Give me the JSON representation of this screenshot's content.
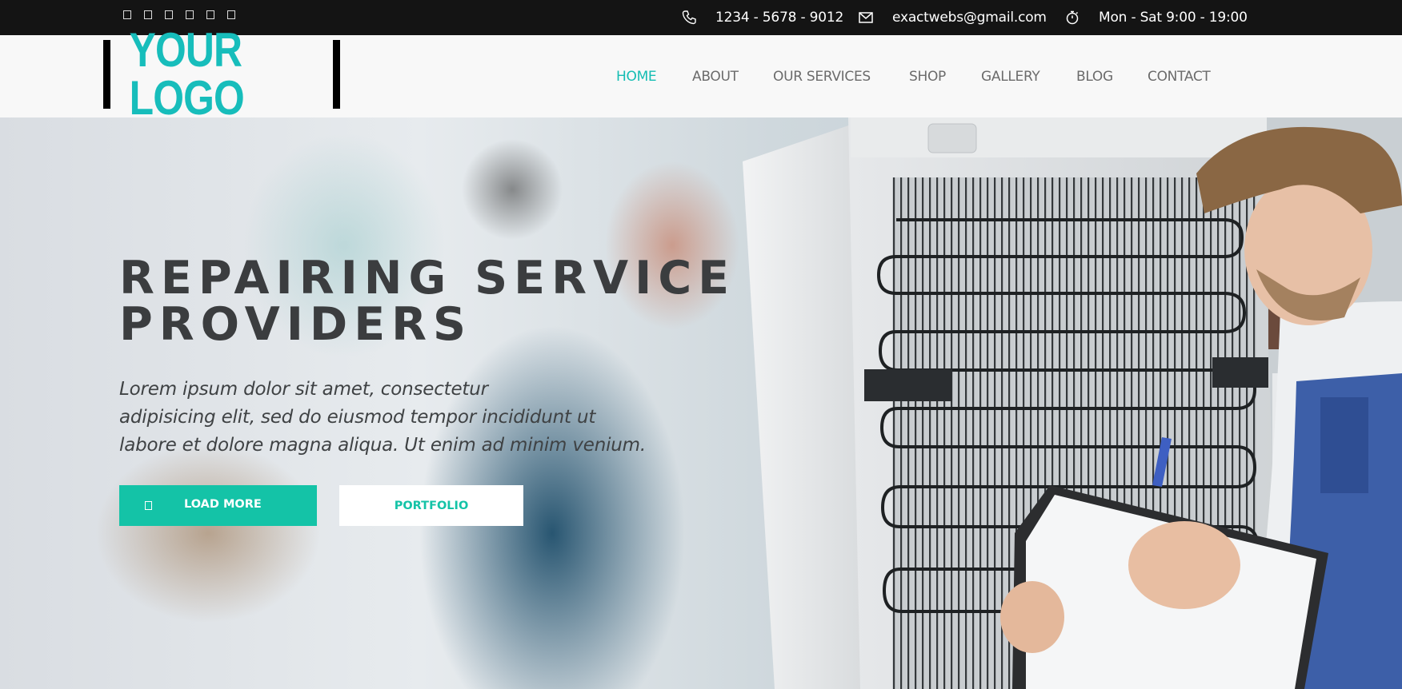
{
  "topbar": {
    "social_icons": [
      "facebook-icon",
      "twitter-icon",
      "google-plus-icon",
      "linkedin-icon",
      "instagram-icon",
      "youtube-icon"
    ],
    "phone": "1234 - 5678 - 9012",
    "email": "exactwebs@gmail.com",
    "hours": "Mon - Sat 9:00 - 19:00",
    "phone_icon": "phone-icon",
    "email_icon": "envelope-icon",
    "hours_icon": "stopwatch-icon"
  },
  "header": {
    "logo_text": "YOUR LOGO",
    "nav": [
      "HOME",
      "ABOUT",
      "OUR SERVICES",
      "SHOP",
      "GALLERY",
      "BLOG",
      "CONTACT"
    ],
    "active_nav": "HOME"
  },
  "hero": {
    "title_line1": "REPAIRING SERVICE",
    "title_line2": "PROVIDERS",
    "text_line1": "Lorem ipsum dolor sit amet, consectetur",
    "text_line2": "adipisicing elit, sed do eiusmod tempor incididunt ut",
    "text_line3": "labore et dolore magna aliqua. Ut enim ad minim venium.",
    "btn_primary": "LOAD MORE",
    "btn_primary_icon": "arrow-icon",
    "btn_secondary": "PORTFOLIO"
  },
  "colors": {
    "accent": "#14c3a7",
    "topbar_bg": "#141414",
    "header_bg": "#f8f8f8",
    "title": "#3b3d3f"
  }
}
